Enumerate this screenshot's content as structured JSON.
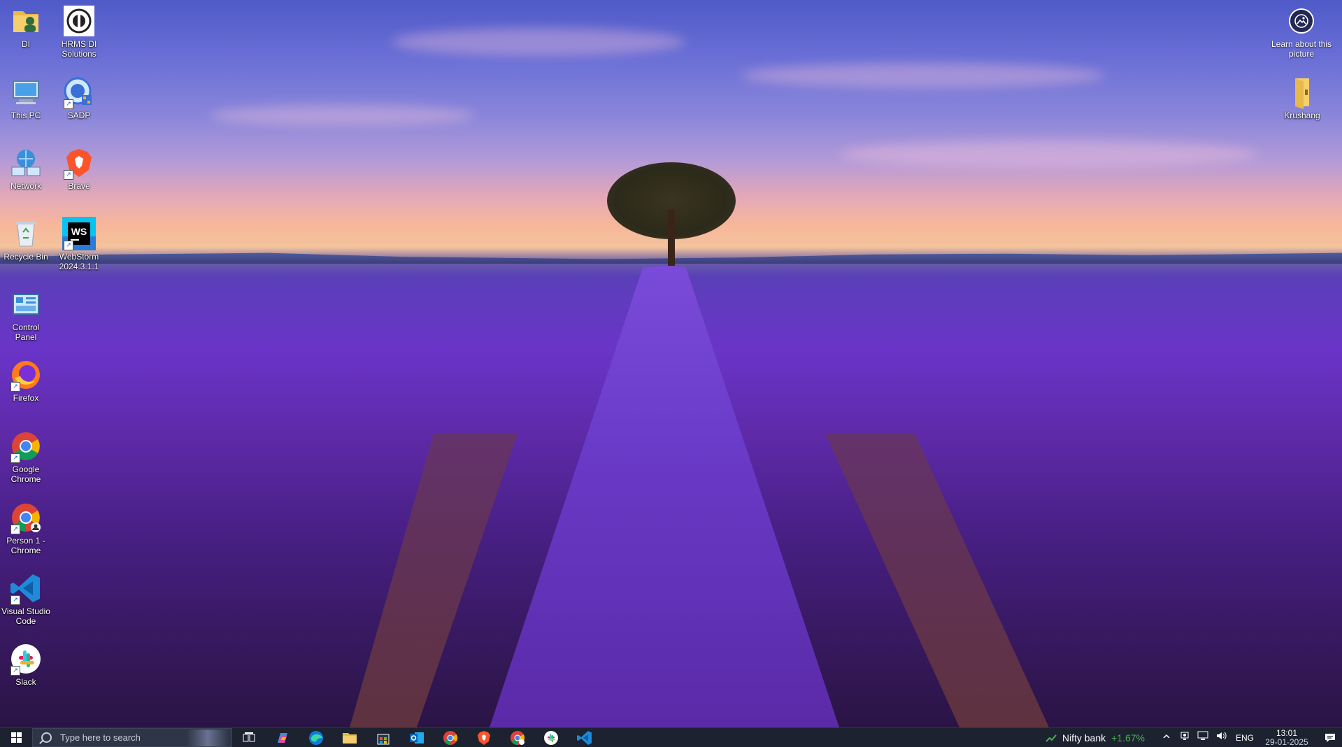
{
  "desktop": {
    "icons_left": [
      {
        "label": "DI",
        "icon": "user-folder-icon"
      },
      {
        "label": "This PC",
        "icon": "computer-icon"
      },
      {
        "label": "Network",
        "icon": "network-icon"
      },
      {
        "label": "Recycle Bin",
        "icon": "recycle-bin-icon"
      },
      {
        "label": "Control Panel",
        "icon": "control-panel-icon"
      },
      {
        "label": "Firefox",
        "icon": "firefox-icon"
      },
      {
        "label": "Google Chrome",
        "icon": "chrome-icon"
      },
      {
        "label": "Person 1 - Chrome",
        "icon": "chrome-profile-icon"
      },
      {
        "label": "Visual Studio Code",
        "icon": "vscode-icon"
      },
      {
        "label": "Slack",
        "icon": "slack-icon"
      }
    ],
    "icons_second": [
      {
        "label": "HRMS DI Solutions",
        "icon": "hrms-icon"
      },
      {
        "label": "SADP",
        "icon": "sadp-icon"
      },
      {
        "label": "Brave",
        "icon": "brave-icon"
      },
      {
        "label": "WebStorm 2024.3.1.1",
        "icon": "webstorm-icon",
        "glyph": "WS"
      }
    ],
    "icons_right": [
      {
        "label": "Learn about this picture",
        "icon": "spotlight-icon"
      },
      {
        "label": "Krushang",
        "icon": "folder-icon"
      }
    ]
  },
  "taskbar": {
    "search_placeholder": "Type here to search",
    "apps": [
      {
        "name": "task-view",
        "icon": "task-view-icon"
      },
      {
        "name": "copilot",
        "icon": "copilot-icon"
      },
      {
        "name": "edge",
        "icon": "edge-icon"
      },
      {
        "name": "file-explorer",
        "icon": "file-explorer-icon"
      },
      {
        "name": "store",
        "icon": "store-icon"
      },
      {
        "name": "outlook",
        "icon": "outlook-icon"
      },
      {
        "name": "chrome",
        "icon": "chrome-icon"
      },
      {
        "name": "brave",
        "icon": "brave-icon"
      },
      {
        "name": "chrome-profile",
        "icon": "chrome-profile-icon"
      },
      {
        "name": "slack",
        "icon": "slack-icon"
      },
      {
        "name": "vscode",
        "icon": "vscode-icon"
      }
    ],
    "stock": {
      "name": "Nifty bank",
      "change": "+1.67%"
    },
    "lang": "ENG",
    "time": "13:01",
    "date": "29-01-2025"
  }
}
